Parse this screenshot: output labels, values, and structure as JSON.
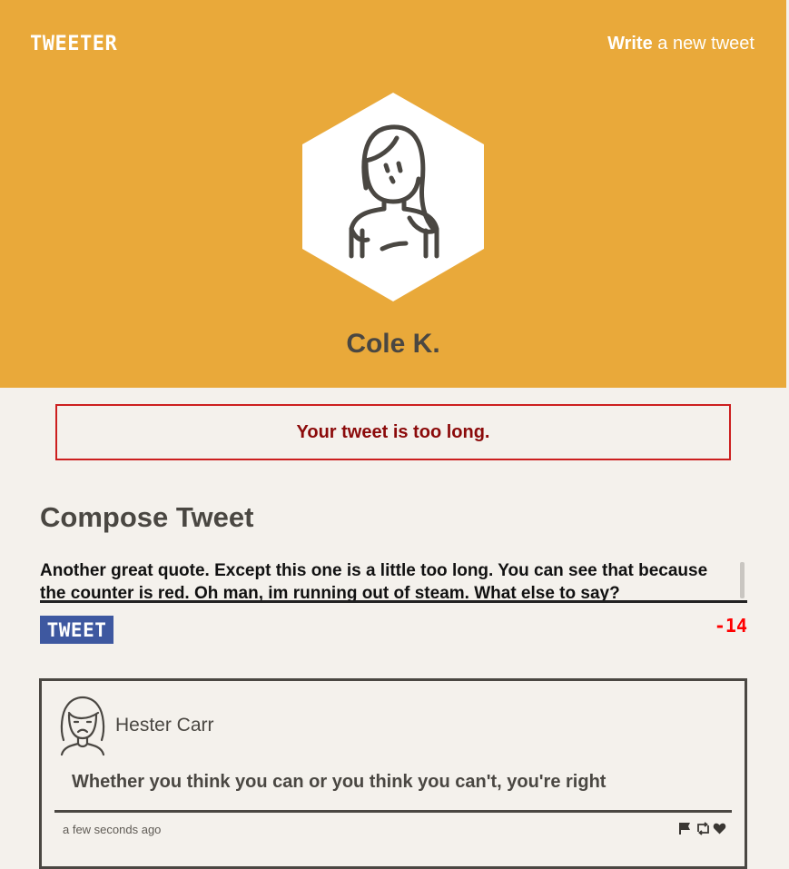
{
  "header": {
    "logo": "TWEETER",
    "write_bold": "Write",
    "write_rest": " a new tweet",
    "bg_color": "#e9a93a"
  },
  "profile": {
    "name": "Cole K.",
    "avatar_icon": "woman-avatar-icon"
  },
  "error": {
    "message": "Your tweet is too long.",
    "color": "#8b0a0a"
  },
  "compose": {
    "title": "Compose Tweet",
    "text": "Another great quote. Except this one is a little too long. You can see that because the counter is red. Oh man, im running out of steam. What else to say?",
    "button_label": "TWEET",
    "button_color": "#3e58a0",
    "counter": "-14",
    "counter_color": "#ff0000"
  },
  "tweets": [
    {
      "author": "Hester Carr",
      "avatar_icon": "sad-woman-avatar-icon",
      "body": "Whether you think you can or you think you can't, you're right",
      "timestamp": "a few seconds ago",
      "actions": [
        "flag-icon",
        "retweet-icon",
        "heart-icon"
      ]
    }
  ]
}
